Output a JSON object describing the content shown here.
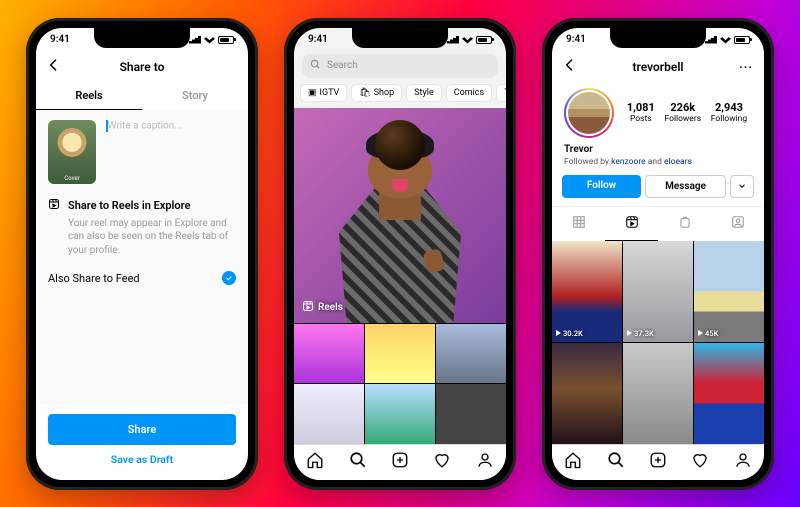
{
  "status": {
    "time": "9:41"
  },
  "phone1": {
    "header_title": "Share to",
    "tabs": {
      "reels": "Reels",
      "story": "Story"
    },
    "cover_label": "Cover",
    "caption_placeholder": "Write a caption...",
    "explore": {
      "title": "Share to Reels in Explore",
      "desc": "Your reel may appear in Explore and can also be seen on the Reels tab of your profile."
    },
    "feed_toggle_label": "Also Share to Feed",
    "share_button": "Share",
    "draft_button": "Save as Draft"
  },
  "phone2": {
    "search_placeholder": "Search",
    "chips": [
      "IGTV",
      "Shop",
      "Style",
      "Comics",
      "TV & Movies"
    ],
    "reels_badge": "Reels"
  },
  "phone3": {
    "username": "trevorbell",
    "stats": {
      "posts": {
        "num": "1,081",
        "label": "Posts"
      },
      "followers": {
        "num": "226k",
        "label": "Followers"
      },
      "following": {
        "num": "2,943",
        "label": "Following"
      }
    },
    "display_name": "Trevor",
    "followed_by_prefix": "Followed by ",
    "followed_by_1": "kenzoore",
    "followed_by_and": " and ",
    "followed_by_2": "eloears",
    "buttons": {
      "follow": "Follow",
      "message": "Message"
    },
    "grid_views": [
      "30.2K",
      "37.3K",
      "45K"
    ]
  }
}
